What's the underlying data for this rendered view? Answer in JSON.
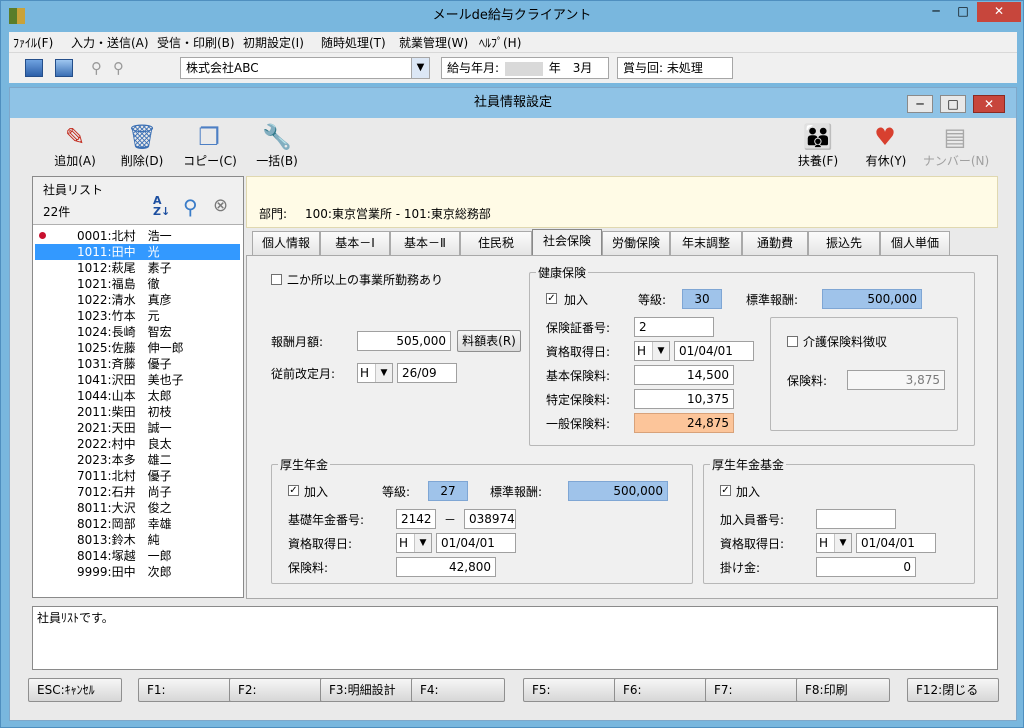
{
  "outer": {
    "title": "メールde給与クライアント"
  },
  "menu": [
    "ﾌｧｲﾙ(F)",
    "入力・送信(A)",
    "受信・印刷(B)",
    "初期設定(I)",
    "随時処理(T)",
    "就業管理(W)",
    "ﾍﾙﾌﾟ(H)"
  ],
  "toolbar": {
    "company": "株式会社ABC",
    "pay_month_label": "給与年月:",
    "pay_month_value": "年　3月",
    "bonus_label": "賞与回:",
    "bonus_value": "未処理"
  },
  "inner": {
    "title": "社員情報設定"
  },
  "actions": {
    "add": "追加(A)",
    "delete": "削除(D)",
    "copy": "コピー(C)",
    "bulk": "一括(B)",
    "dependents": "扶養(F)",
    "leave": "有休(Y)",
    "number": "ナンバー(N)"
  },
  "list": {
    "title": "社員リスト",
    "count": "22件",
    "employees": [
      "0001:北村　浩一",
      "1011:田中　光",
      "1012:萩尾　素子",
      "1021:福島　徹",
      "1022:清水　真彦",
      "1023:竹本　元",
      "1024:長崎　智宏",
      "1025:佐藤　伸一郎",
      "1031:斉藤　優子",
      "1041:沢田　美也子",
      "1044:山本　太郎",
      "2011:柴田　初枝",
      "2021:天田　誠一",
      "2022:村中　良太",
      "2023:本多　雄二",
      "7011:北村　優子",
      "7012:石井　尚子",
      "8011:大沢　俊之",
      "8012:岡部　幸雄",
      "8013:鈴木　純",
      "8014:塚越　一郎",
      "9999:田中　次郎"
    ]
  },
  "dept": {
    "label": "部門:",
    "value": "100:東京営業所 - 101:東京総務部"
  },
  "tabs": [
    "個人情報",
    "基本－Ⅰ",
    "基本－Ⅱ",
    "住民税",
    "社会保険",
    "労働保険",
    "年末調整",
    "通勤費",
    "振込先",
    "個人単価"
  ],
  "form": {
    "multi_office": "二か所以上の事業所勤務あり",
    "salary_label": "報酬月額:",
    "salary_value": "505,000",
    "rate_btn": "料額表(R)",
    "prev_rev_label": "従前改定月:",
    "prev_rev_era": "H",
    "prev_rev_value": "26/09"
  },
  "health": {
    "title": "健康保険",
    "enroll": "加入",
    "grade_label": "等級:",
    "grade_value": "30",
    "std_label": "標準報酬:",
    "std_value": "500,000",
    "cert_label": "保険証番号:",
    "cert_value": "2",
    "acq_label": "資格取得日:",
    "acq_era": "H",
    "acq_value": "01/04/01",
    "basic_label": "基本保険料:",
    "basic_value": "14,500",
    "special_label": "特定保険料:",
    "special_value": "10,375",
    "general_label": "一般保険料:",
    "general_value": "24,875"
  },
  "care": {
    "title": "介護保険料徴収",
    "fee_label": "保険料:",
    "fee_value": "3,875"
  },
  "pension": {
    "title": "厚生年金",
    "enroll": "加入",
    "grade_label": "等級:",
    "grade_value": "27",
    "std_label": "標準報酬:",
    "std_value": "500,000",
    "basic_no_label": "基礎年金番号:",
    "basic_no_1": "2142",
    "basic_no_sep": "－",
    "basic_no_2": "038974",
    "acq_label": "資格取得日:",
    "acq_era": "H",
    "acq_value": "01/04/01",
    "fee_label": "保険料:",
    "fee_value": "42,800"
  },
  "fund": {
    "title": "厚生年金基金",
    "enroll": "加入",
    "member_label": "加入員番号:",
    "member_value": "",
    "acq_label": "資格取得日:",
    "acq_era": "H",
    "acq_value": "01/04/01",
    "premium_label": "掛け金:",
    "premium_value": "0"
  },
  "status": {
    "message": "社員ﾘｽﾄです。"
  },
  "fkeys": [
    "ESC:ｷｬﾝｾﾙ",
    "F1:",
    "F2:",
    "F3:明細設計",
    "F4:",
    "F5:",
    "F6:",
    "F7:",
    "F8:印刷",
    "F12:閉じる"
  ]
}
